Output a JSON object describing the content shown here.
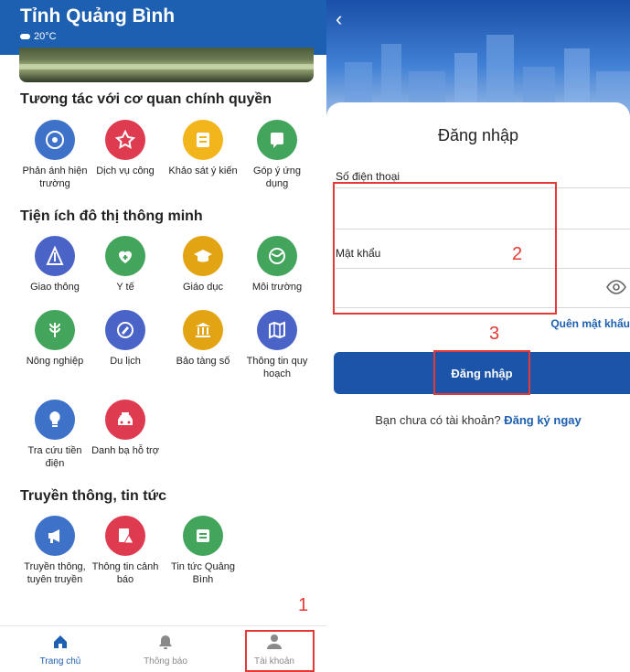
{
  "left": {
    "header": {
      "title": "Tỉnh Quảng Bình",
      "weather_icon": "cloud-icon",
      "weather": "20°C"
    },
    "sections": [
      {
        "title": "Tương tác với cơ quan chính quyền"
      },
      {
        "title": "Tiện ích đô thị thông minh"
      },
      {
        "title": "Truyền thông, tin tức"
      }
    ],
    "tiles": [
      {
        "label": "Phản ánh hiện trường",
        "icon": "feedback-icon",
        "color": "#3e72c9"
      },
      {
        "label": "Dịch vụ công",
        "icon": "public-service-icon",
        "color": "#df3b50"
      },
      {
        "label": "Khảo sát ý kiến",
        "icon": "survey-icon",
        "color": "#f2b51c"
      },
      {
        "label": "Góp ý ứng dụng",
        "icon": "app-feedback-icon",
        "color": "#43a55c"
      },
      {
        "label": "Giao thông",
        "icon": "traffic-icon",
        "color": "#4a63c7"
      },
      {
        "label": "Y tế",
        "icon": "health-icon",
        "color": "#43a55c"
      },
      {
        "label": "Giáo dục",
        "icon": "education-icon",
        "color": "#e3a414"
      },
      {
        "label": "Môi trường",
        "icon": "environment-icon",
        "color": "#43a55c"
      },
      {
        "label": "Nông nghiệp",
        "icon": "agriculture-icon",
        "color": "#43a55c"
      },
      {
        "label": "Du lịch",
        "icon": "travel-icon",
        "color": "#4a63c7"
      },
      {
        "label": "Bảo tàng số",
        "icon": "museum-icon",
        "color": "#e3a414"
      },
      {
        "label": "Thông tin quy hoạch",
        "icon": "planning-map-icon",
        "color": "#4a63c7"
      },
      {
        "label": "Tra cứu tiền điện",
        "icon": "electricity-icon",
        "color": "#3e72c9"
      },
      {
        "label": "Danh bạ hỗ trợ",
        "icon": "taxi-directory-icon",
        "color": "#df3b50"
      },
      {
        "label": "Truyền thông, tuyên truyền",
        "icon": "megaphone-icon",
        "color": "#3e72c9"
      },
      {
        "label": "Thông tin cảnh báo",
        "icon": "warning-icon",
        "color": "#df3b50"
      },
      {
        "label": "Tin tức Quảng Bình",
        "icon": "news-icon",
        "color": "#43a55c"
      }
    ],
    "nav": [
      {
        "label": "Trang chủ",
        "icon": "home-icon",
        "active": true
      },
      {
        "label": "Thông báo",
        "icon": "bell-icon",
        "active": false
      },
      {
        "label": "Tài khoản",
        "icon": "user-icon",
        "active": false
      }
    ],
    "annotation": "1"
  },
  "right": {
    "back_icon": "back-chevron-icon",
    "form_title": "Đăng nhập",
    "phone_label": "Số điện thoại",
    "phone_value": "",
    "password_label": "Mật khẩu",
    "password_value": "",
    "eye_icon": "eye-icon",
    "forgot": "Quên mật khẩu",
    "login_button": "Đăng nhập",
    "register_prompt": "Bạn chưa có tài khoản?",
    "register_link": "Đăng ký ngay",
    "annotation_fields": "2",
    "annotation_button": "3"
  },
  "colors": {
    "primary": "#1d5fb0",
    "annotation": "#e53935"
  }
}
